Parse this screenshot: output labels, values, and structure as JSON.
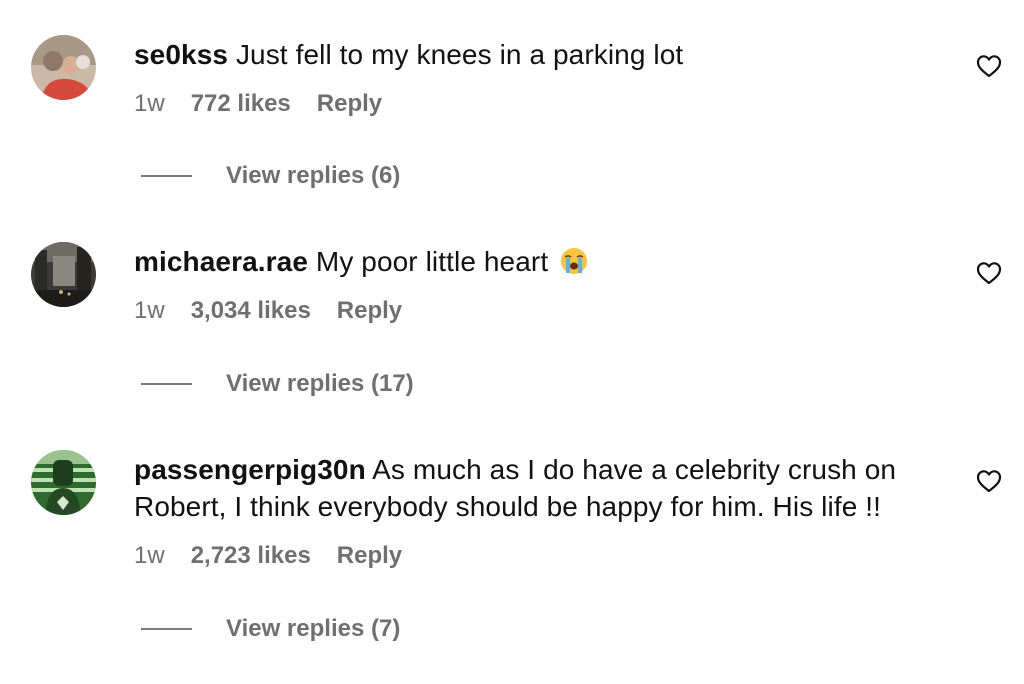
{
  "comments": [
    {
      "username": "se0kss",
      "text": "Just fell to my knees in a parking lot",
      "time": "1w",
      "likes": "772 likes",
      "reply": "Reply",
      "view_replies": "View replies (6)",
      "avatar_icon": "profile-photo-red-shirt"
    },
    {
      "username": "michaera.rae",
      "text": "My poor little heart",
      "emoji": "loudly-crying-face-emoji",
      "time": "1w",
      "likes": "3,034 likes",
      "reply": "Reply",
      "view_replies": "View replies (17)",
      "avatar_icon": "profile-photo-city-street"
    },
    {
      "username": "passengerpig30n",
      "text": "As much as I do have a celebrity crush on",
      "text_line2": "Robert, I think everybody should be happy for him. His life !!",
      "time": "1w",
      "likes": "2,723 likes",
      "reply": "Reply",
      "view_replies": "View replies (7)",
      "avatar_icon": "profile-photo-green-figure"
    }
  ],
  "icons": {
    "like": "heart-outline-icon"
  },
  "colors": {
    "text": "#111111",
    "secondary": "#6f6f6f",
    "background": "#ffffff"
  }
}
